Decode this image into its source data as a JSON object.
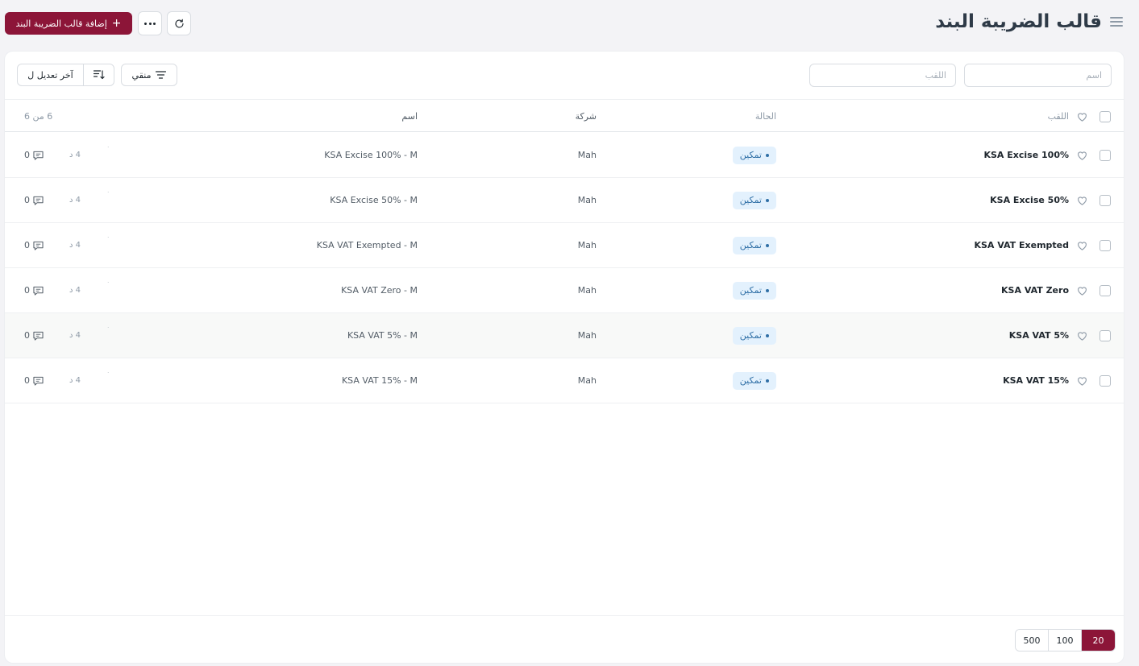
{
  "header": {
    "title": "قالب الضريبة البند",
    "add_button_label": "إضافة قالب الضريبة البند",
    "add_button_icon": "plus-icon",
    "more_icon": "ellipsis-icon",
    "refresh_icon": "refresh-icon",
    "menu_icon": "hamburger-icon"
  },
  "filters": {
    "name_placeholder": "اسم",
    "title_placeholder": "اللقب",
    "filter_button_label": "منقي",
    "sort_label": "آخر تعديل ل"
  },
  "table": {
    "columns": {
      "title": "اللقب",
      "status": "الحالة",
      "company": "شركة",
      "name": "اسم",
      "count": "6 من 6"
    },
    "rows": [
      {
        "title": "KSA Excise 100%",
        "status": "تمكين",
        "company": "Mah",
        "name": "KSA Excise 100% - M",
        "modified": "4 د",
        "comments": "0"
      },
      {
        "title": "KSA Excise 50%",
        "status": "تمكين",
        "company": "Mah",
        "name": "KSA Excise 50% - M",
        "modified": "4 د",
        "comments": "0"
      },
      {
        "title": "KSA VAT Exempted",
        "status": "تمكين",
        "company": "Mah",
        "name": "KSA VAT Exempted - M",
        "modified": "4 د",
        "comments": "0"
      },
      {
        "title": "KSA VAT Zero",
        "status": "تمكين",
        "company": "Mah",
        "name": "KSA VAT Zero - M",
        "modified": "4 د",
        "comments": "0"
      },
      {
        "title": "KSA VAT 5%",
        "status": "تمكين",
        "company": "Mah",
        "name": "KSA VAT 5% - M",
        "modified": "4 د",
        "comments": "0"
      },
      {
        "title": "KSA VAT 15%",
        "status": "تمكين",
        "company": "Mah",
        "name": "KSA VAT 15% - M",
        "modified": "4 د",
        "comments": "0"
      }
    ]
  },
  "pagination": {
    "options": [
      "500",
      "100",
      "20"
    ],
    "selected": "20"
  },
  "colors": {
    "primary": "#8c1538",
    "status_bg": "#e3f1fd",
    "status_text": "#2f6fa6"
  }
}
